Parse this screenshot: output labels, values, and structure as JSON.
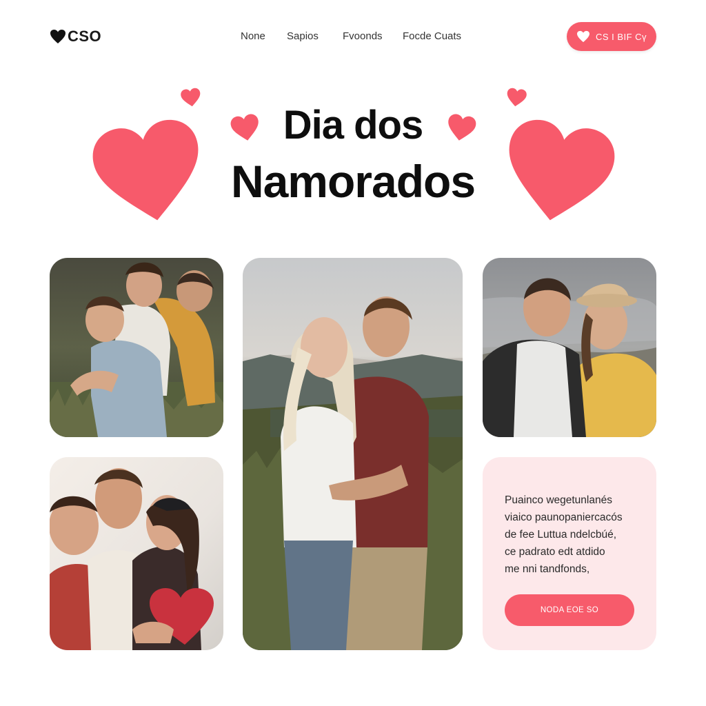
{
  "brand": {
    "logo_text": "CSO",
    "logo_icon": "heart-icon"
  },
  "nav": {
    "items": [
      "Nоne",
      "Sapios",
      "Fvoonds",
      "Focde Cuats"
    ]
  },
  "header_cta": {
    "label": "CS I BIF Cү",
    "icon": "heart-icon"
  },
  "hero": {
    "title_line1": "Dia dos",
    "title_line2": "Namorados"
  },
  "gallery": {
    "photos": [
      {
        "subject": "friends-hugging-in-field-photo"
      },
      {
        "subject": "couple-embracing-on-hill-photo"
      },
      {
        "subject": "couple-smiling-by-sea-photo"
      },
      {
        "subject": "couple-kissing-with-heart-photo"
      }
    ]
  },
  "promo_card": {
    "lines": [
      "Puaіnco wegetunlanés",
      "vіaіco paunopaniercacós",
      "de fee Luttua ndelcbúé,",
      "ce padrato edt atdido",
      "me nni tandfonds,"
    ],
    "button_label": "NODA EOE SO"
  },
  "colors": {
    "accent": "#f75b6b",
    "card_bg": "#fde8ea",
    "heart": "#f75a6b"
  }
}
